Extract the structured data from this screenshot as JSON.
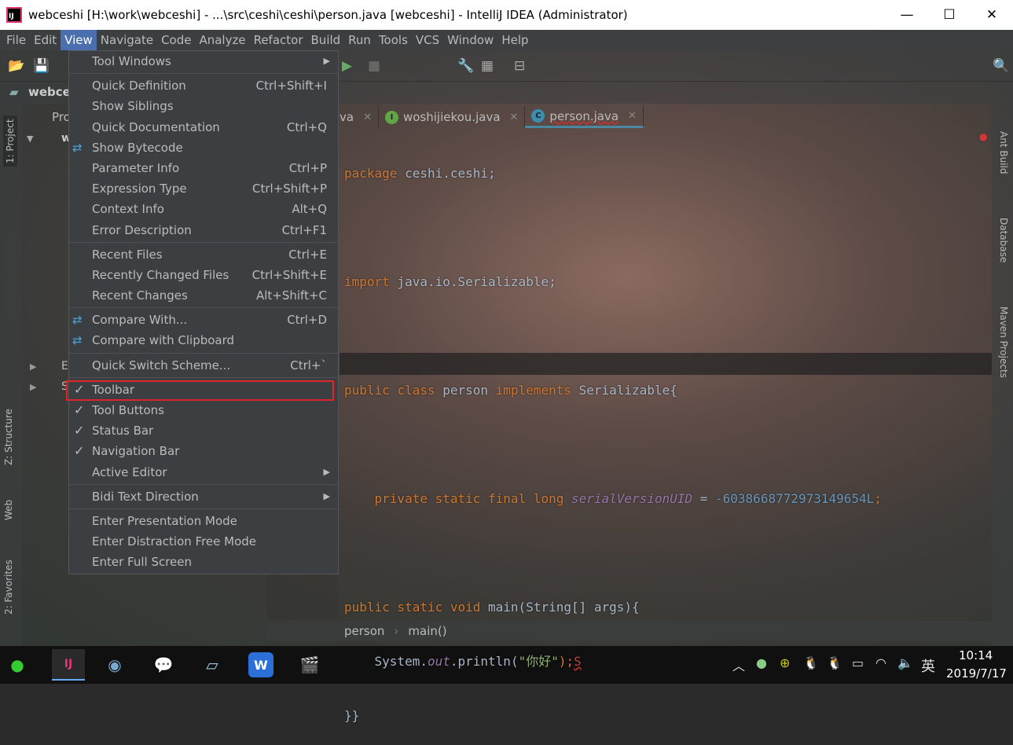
{
  "window": {
    "title": "webceshi [H:\\work\\webceshi] - ...\\src\\ceshi\\ceshi\\person.java [webceshi] - IntelliJ IDEA (Administrator)",
    "minimize": "—",
    "maximize": "☐",
    "close": "✕"
  },
  "menubar": [
    "File",
    "Edit",
    "View",
    "Navigate",
    "Code",
    "Analyze",
    "Refactor",
    "Build",
    "Run",
    "Tools",
    "VCS",
    "Window",
    "Help"
  ],
  "navbar": {
    "project": "webce"
  },
  "left_tools": {
    "project": "1: Project",
    "structure": "Z: Structure",
    "web": "Web",
    "favorites": "2: Favorites"
  },
  "right_tools": {
    "ant": "Ant Build",
    "database": "Database",
    "maven": "Maven Projects"
  },
  "project_panel": {
    "header": "Pro",
    "root": "we",
    "ext": "E",
    "s": "S"
  },
  "tabs": [
    {
      "label": "va",
      "icon": "java"
    },
    {
      "label": "woshijiekou.java",
      "icon": "I",
      "color": "#62a547"
    },
    {
      "label": "person.java",
      "icon": "C",
      "color": "#3c8dae"
    }
  ],
  "code": {
    "l1": [
      "package",
      " ceshi.ceshi;"
    ],
    "l3": [
      "import",
      " java.io.Serializable;"
    ],
    "l5": [
      "public class",
      " person ",
      "implements",
      " Serializable{"
    ],
    "l7": [
      "    private static final long ",
      "serialVersionUID",
      " = ",
      "-6038668772973149654L",
      ";"
    ],
    "l9": [
      "public static void",
      " main(String[] args){"
    ],
    "l10": [
      "    System.",
      "out",
      ".println(",
      "\"你好\"",
      ");",
      "S"
    ],
    "l11": [
      "}}"
    ]
  },
  "breadcrumb": [
    "person",
    "main()"
  ],
  "view_menu": [
    {
      "label": "Tool Windows",
      "arrow": "▶"
    },
    "sep",
    {
      "label": "Quick Definition",
      "shortcut": "Ctrl+Shift+I"
    },
    {
      "label": "Show Siblings"
    },
    {
      "label": "Quick Documentation",
      "shortcut": "Ctrl+Q"
    },
    {
      "label": "Show Bytecode",
      "icon": "bytecode"
    },
    {
      "label": "Parameter Info",
      "shortcut": "Ctrl+P"
    },
    {
      "label": "Expression Type",
      "shortcut": "Ctrl+Shift+P"
    },
    {
      "label": "Context Info",
      "shortcut": "Alt+Q"
    },
    {
      "label": "Error Description",
      "shortcut": "Ctrl+F1"
    },
    "sep",
    {
      "label": "Recent Files",
      "shortcut": "Ctrl+E"
    },
    {
      "label": "Recently Changed Files",
      "shortcut": "Ctrl+Shift+E"
    },
    {
      "label": "Recent Changes",
      "shortcut": "Alt+Shift+C"
    },
    "sep",
    {
      "label": "Compare With...",
      "shortcut": "Ctrl+D",
      "icon": "compare"
    },
    {
      "label": "Compare with Clipboard",
      "icon": "clipboard"
    },
    "sep",
    {
      "label": "Quick Switch Scheme...",
      "shortcut": "Ctrl+`"
    },
    "sep",
    {
      "label": "Toolbar",
      "checked": "✓"
    },
    {
      "label": "Tool Buttons",
      "checked": "✓"
    },
    {
      "label": "Status Bar",
      "checked": "✓"
    },
    {
      "label": "Navigation Bar",
      "checked": "✓"
    },
    {
      "label": "Active Editor",
      "arrow": "▶"
    },
    "sep",
    {
      "label": "Bidi Text Direction",
      "arrow": "▶"
    },
    "sep",
    {
      "label": "Enter Presentation Mode"
    },
    {
      "label": "Enter Distraction Free Mode"
    },
    {
      "label": "Enter Full Screen"
    }
  ],
  "tray": {
    "chevron": "︿",
    "ime": "英",
    "time": "10:14",
    "date": "2019/7/17"
  }
}
